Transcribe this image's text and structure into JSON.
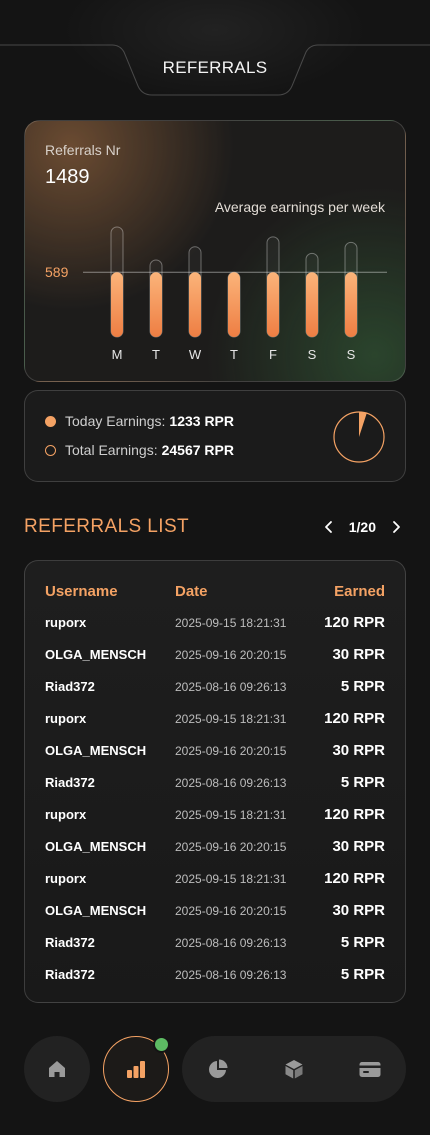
{
  "header": {
    "title": "REFERRALS"
  },
  "referrals": {
    "label": "Referrals Nr",
    "count": "1489",
    "avg_label": "Average earnings per week",
    "avg_value": "589"
  },
  "chart_data": {
    "type": "bar",
    "title": "Average earnings per week",
    "categories": [
      "M",
      "T",
      "W",
      "T",
      "F",
      "S",
      "S"
    ],
    "reference_line": {
      "label": "589",
      "value": 589
    },
    "values": [
      589,
      589,
      589,
      589,
      589,
      589,
      589
    ],
    "capacity": [
      1000,
      700,
      820,
      589,
      910,
      760,
      860
    ],
    "accent": "#f4a264"
  },
  "earnings": {
    "today_label": "Today Earnings:",
    "today_value": "1233 RPR",
    "total_label": "Total Earnings:",
    "total_value": "24567 RPR",
    "pie_share": 0.05
  },
  "list": {
    "title": "REFERRALS LIST",
    "page": "1/20",
    "columns": {
      "user": "Username",
      "date": "Date",
      "earned": "Earned"
    },
    "rows": [
      {
        "user": "ruporx",
        "date": "2025-09-15 18:21:31",
        "earned": "120 RPR"
      },
      {
        "user": "OLGA_MENSCH",
        "date": "2025-09-16 20:20:15",
        "earned": "30 RPR"
      },
      {
        "user": "Riad372",
        "date": "2025-08-16 09:26:13",
        "earned": "5 RPR"
      },
      {
        "user": "ruporx",
        "date": "2025-09-15 18:21:31",
        "earned": "120 RPR"
      },
      {
        "user": "OLGA_MENSCH",
        "date": "2025-09-16 20:20:15",
        "earned": "30 RPR"
      },
      {
        "user": "Riad372",
        "date": "2025-08-16 09:26:13",
        "earned": "5 RPR"
      },
      {
        "user": "ruporx",
        "date": "2025-09-15 18:21:31",
        "earned": "120 RPR"
      },
      {
        "user": "OLGA_MENSCH",
        "date": "2025-09-16 20:20:15",
        "earned": "30 RPR"
      },
      {
        "user": "ruporx",
        "date": "2025-09-15 18:21:31",
        "earned": "120 RPR"
      },
      {
        "user": "OLGA_MENSCH",
        "date": "2025-09-16 20:20:15",
        "earned": "30 RPR"
      },
      {
        "user": "Riad372",
        "date": "2025-08-16 09:26:13",
        "earned": "5 RPR"
      },
      {
        "user": "Riad372",
        "date": "2025-08-16 09:26:13",
        "earned": "5 RPR"
      }
    ]
  },
  "nav": {
    "items": [
      "home-icon",
      "bar-chart-icon",
      "pie-chart-icon",
      "cube-icon",
      "card-icon"
    ],
    "active": "bar-chart-icon",
    "badge_color": "#5dbb63"
  }
}
